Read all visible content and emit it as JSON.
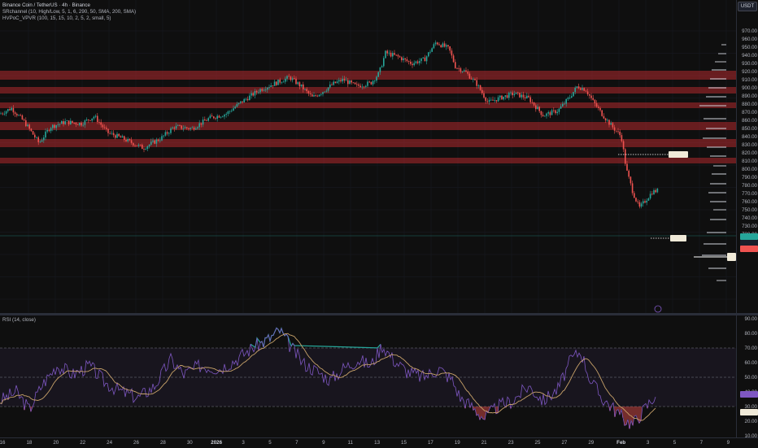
{
  "legend": {
    "symbol": "Binance Coin / TetherUS · 4h · Binance",
    "indicator1": "SRchannel (10, High/Low, 5, 1, 6, 290, 50, SMA, 200, SMA)",
    "indicator2": "HVPoC_VPVR (100, 15, 15, 10, 2, 5, 2, small, 5)"
  },
  "rsi_legend": "RSI (14, close)",
  "currency": "USDT",
  "price_ticks": [
    "970.00",
    "960.00",
    "950.00",
    "940.00",
    "930.00",
    "920.00",
    "910.00",
    "900.00",
    "890.00",
    "880.00",
    "870.00",
    "860.00",
    "850.00",
    "840.00",
    "830.00",
    "820.00",
    "810.00",
    "800.00",
    "790.00",
    "780.00",
    "770.00",
    "760.00",
    "750.00",
    "740.00",
    "730.00",
    "720.00",
    "710.00"
  ],
  "rsi_ticks": [
    "90.00",
    "80.00",
    "70.00",
    "60.00",
    "50.00",
    "40.00",
    "30.00",
    "20.00",
    "10.00"
  ],
  "time_ticks": [
    "16",
    "18",
    "20",
    "22",
    "24",
    "26",
    "28",
    "30",
    "2026",
    "3",
    "5",
    "7",
    "9",
    "11",
    "13",
    "15",
    "17",
    "19",
    "21",
    "23",
    "25",
    "27",
    "29",
    "Feb",
    "3",
    "5",
    "7",
    "9"
  ],
  "colors": {
    "up": "#26a69a",
    "down": "#ef5350",
    "zone": "#b2292e",
    "rsi": "#7e57c2",
    "rsi_ma": "#c9a36a"
  }
}
